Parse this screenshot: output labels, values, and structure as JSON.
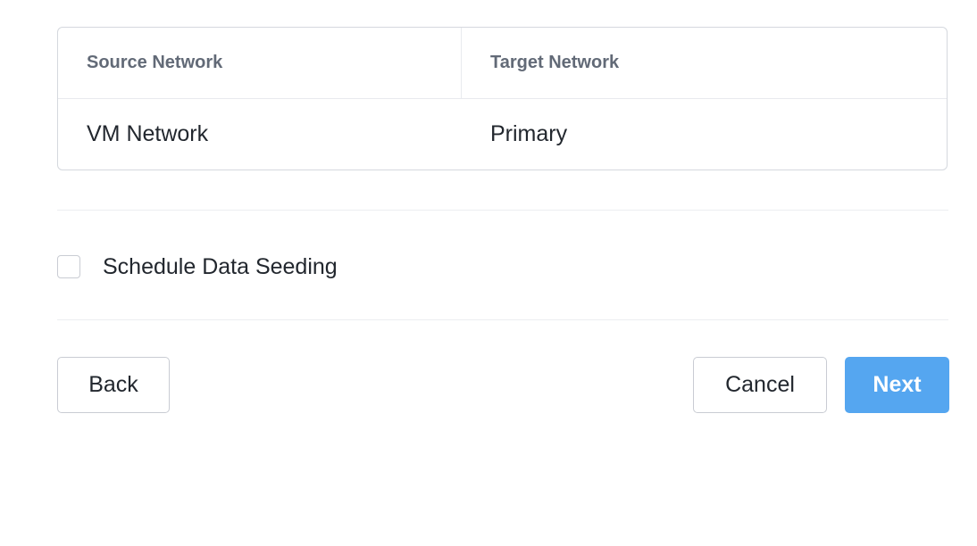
{
  "network_mapping": {
    "columns": [
      "Source Network",
      "Target Network"
    ],
    "rows": [
      {
        "source": "VM Network",
        "target": "Primary"
      }
    ]
  },
  "seeding": {
    "label": "Schedule Data Seeding",
    "checked": false
  },
  "footer": {
    "back_label": "Back",
    "cancel_label": "Cancel",
    "next_label": "Next"
  },
  "colors": {
    "primary": "#55a6f0",
    "border": "#c9ccd3",
    "header_text": "#626a77"
  }
}
